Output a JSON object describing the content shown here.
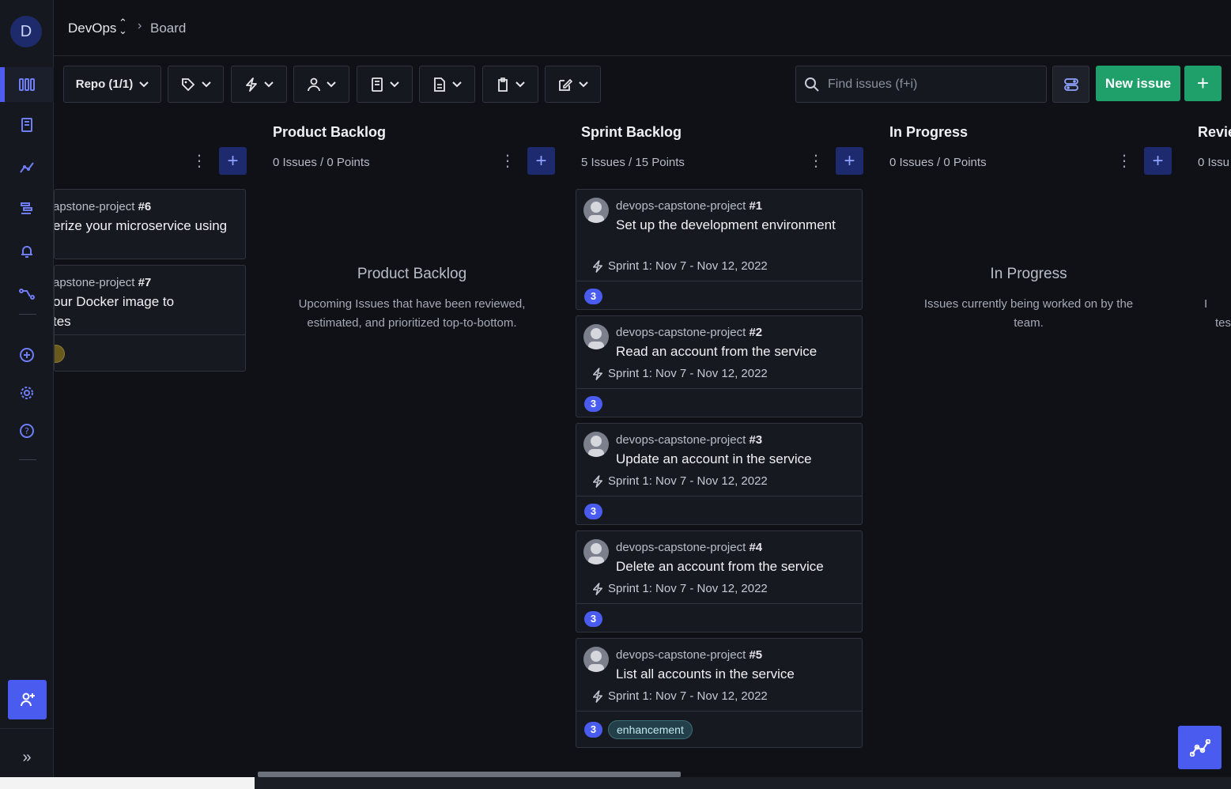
{
  "app": {
    "user_initial": "D",
    "breadcrumb": {
      "project": "DevOps",
      "page": "Board"
    }
  },
  "toolbar": {
    "repo_label": "Repo (1/1)",
    "filters": [
      "tag-icon",
      "sprint-icon",
      "user-icon",
      "epic-icon",
      "release-icon",
      "estimate-icon",
      "edit-icon"
    ],
    "search_placeholder": "Find issues (f+i)",
    "new_issue_label": "New issue",
    "add_label": "+"
  },
  "columns": [
    {
      "title": "",
      "count": "",
      "cards": [
        {
          "repo": "apstone-project ",
          "number": "#6",
          "title_lines": [
            "erize your microservice using"
          ]
        },
        {
          "repo": "apstone-project ",
          "number": "#7",
          "title_lines": [
            "our Docker image to",
            "tes"
          ]
        }
      ]
    },
    {
      "title": "Product Backlog",
      "count": "0 Issues / 0 Points",
      "empty_title": "Product Backlog",
      "empty_desc": "Upcoming Issues that have been reviewed, estimated, and prioritized top-to-bottom."
    },
    {
      "title": "Sprint Backlog",
      "count": "5 Issues / 15 Points",
      "cards": [
        {
          "repo": "devops-capstone-project ",
          "number": "#1",
          "title": "Set up the development environment",
          "sprint": "Sprint 1: Nov 7 - Nov 12, 2022",
          "points": "3"
        },
        {
          "repo": "devops-capstone-project ",
          "number": "#2",
          "title": "Read an account from the service",
          "sprint": "Sprint 1: Nov 7 - Nov 12, 2022",
          "points": "3"
        },
        {
          "repo": "devops-capstone-project ",
          "number": "#3",
          "title": "Update an account in the service",
          "sprint": "Sprint 1: Nov 7 - Nov 12, 2022",
          "points": "3"
        },
        {
          "repo": "devops-capstone-project ",
          "number": "#4",
          "title": "Delete an account from the service",
          "sprint": "Sprint 1: Nov 7 - Nov 12, 2022",
          "points": "3"
        },
        {
          "repo": "devops-capstone-project ",
          "number": "#5",
          "title": "List all accounts in the service",
          "sprint": "Sprint 1: Nov 7 - Nov 12, 2022",
          "points": "3",
          "label": "enhancement"
        }
      ]
    },
    {
      "title": "In Progress",
      "count": "0 Issues / 0 Points",
      "empty_title": "In Progress",
      "empty_desc": "Issues currently being worked on by the team."
    },
    {
      "title": "Revie",
      "count": "0 Issu",
      "empty_desc_lines": [
        "I",
        "tes"
      ]
    }
  ],
  "colors": {
    "accent": "#4a5cf0",
    "success": "#1fa06a",
    "background": "#0f1117"
  }
}
